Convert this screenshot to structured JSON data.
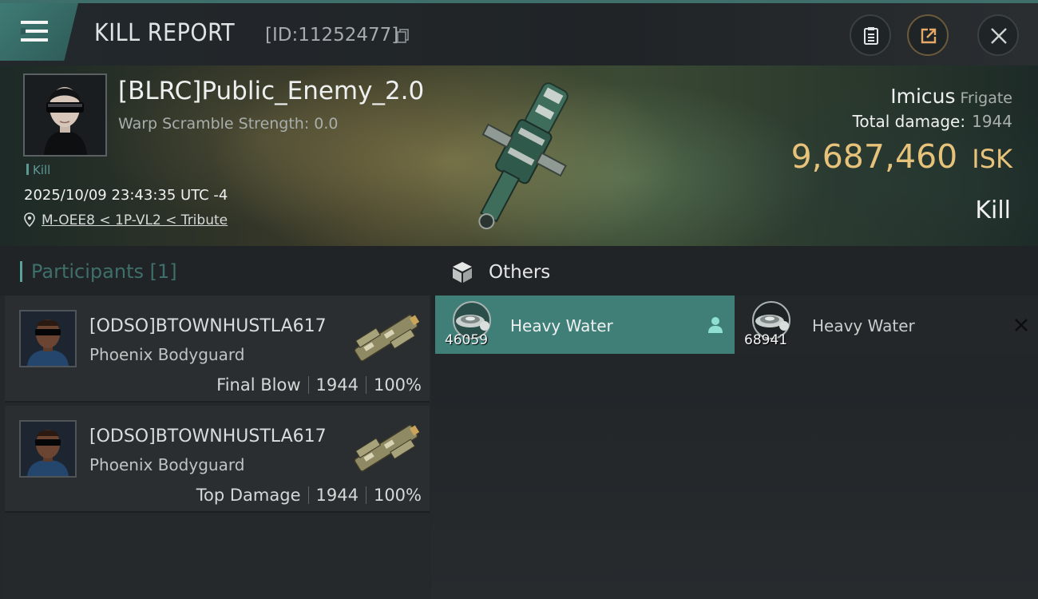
{
  "header": {
    "title": "KILL REPORT",
    "report_id": "[ID:11252477]"
  },
  "victim": {
    "name": "[BLRC]Public_Enemy_2.0",
    "warp_scramble": "Warp Scramble Strength: 0.0",
    "tag": "Kill",
    "timestamp": "2025/10/09 23:43:35 UTC -4",
    "location": "M-OEE8 < 1P-VL2 < Tribute",
    "ship": "Imicus",
    "ship_class": "Frigate",
    "total_damage_label": "Total damage:",
    "total_damage": "1944",
    "isk_value": "9,687,460",
    "isk_unit": "ISK",
    "result": "Kill"
  },
  "participants": {
    "title": "Participants [1]",
    "rows": [
      {
        "name": "[ODSO]BTOWNHUSTLA617",
        "ship": "Phoenix Bodyguard",
        "role": "Final Blow",
        "damage": "1944",
        "percent": "100%"
      },
      {
        "name": "[ODSO]BTOWNHUSTLA617",
        "ship": "Phoenix Bodyguard",
        "role": "Top Damage",
        "damage": "1944",
        "percent": "100%"
      }
    ]
  },
  "others": {
    "title": "Others",
    "items": [
      {
        "name": "Heavy Water",
        "qty": "46059",
        "icon": "person-icon"
      },
      {
        "name": "Heavy Water",
        "qty": "68941",
        "icon": "close-icon"
      }
    ]
  },
  "colors": {
    "accent": "#3f7f78",
    "isk": "#e7c27a",
    "background": "#1a1d20"
  }
}
